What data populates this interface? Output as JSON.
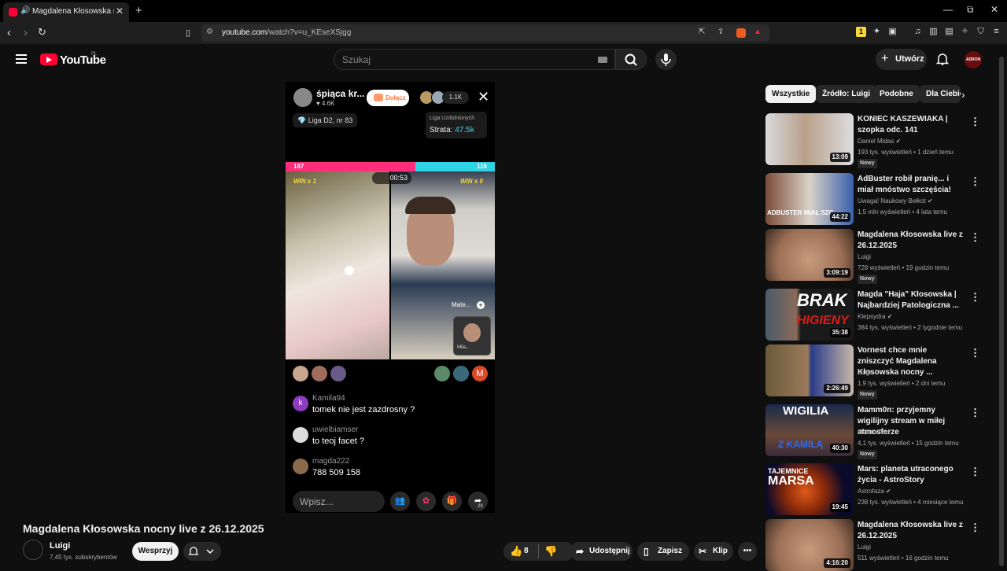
{
  "browser": {
    "tab_title": "Magdalena Kłosowska nocny",
    "tab_close": "✕",
    "new_tab": "+",
    "win_min": "—",
    "win_max": "⧉",
    "win_close": "✕",
    "url_domain": "youtube.com",
    "url_path": "/watch?v=u_KEseXSjgg"
  },
  "header": {
    "logo_text": "YouTube",
    "country": "PL",
    "search_placeholder": "Szukaj",
    "create_label": "Utwórz",
    "avatar_text": "ADRON"
  },
  "player": {
    "host_name": "śpiąca kr...",
    "host_likes": "♥ 4.6K",
    "join_label": "Dołącz",
    "viewer_count": "1.1K",
    "league": "Liga D2, nr 83",
    "strata_title": "Liga Uzdolnionych",
    "strata_label": "Strata: ",
    "strata_value": "47.5k",
    "score_left": "187",
    "score_right": "116",
    "win_left": "WIN x 1",
    "win_right": "WIN x 0",
    "timer": "00:53",
    "guest_name": "Mate...",
    "pip_name": "Mila...",
    "chat": [
      {
        "user": "Kamila94",
        "text": "tomek nie jest zazdrosny ?",
        "avatar_letter": "k"
      },
      {
        "user": "uwielbiamser",
        "text": "to teoj facet ?",
        "avatar_letter": ""
      },
      {
        "user": "magda222",
        "text": "788 509 158",
        "avatar_letter": ""
      }
    ],
    "input_placeholder": "Wpisz...",
    "share_count": "29"
  },
  "video": {
    "title": "Magdalena Kłosowska nocny live z 26.12.2025",
    "channel": "Luigi",
    "subscribers": "7,45 tys. subskrybentów",
    "support_label": "Wesprzyj",
    "like_count": "8",
    "share_label": "Udostępnij",
    "save_label": "Zapisz",
    "clip_label": "Klip"
  },
  "chips": [
    "Wszystkie",
    "Źródło: Luigi",
    "Podobne",
    "Dla Ciebie"
  ],
  "recommendations": [
    {
      "title": "KONIEC KASZEWIAKA | szopka odc. 141",
      "channel": "Daniel Midas",
      "meta": "193 tys. wyświetleń • 1 dzień temu",
      "duration": "13:09",
      "new": "Nowy",
      "verified": true
    },
    {
      "title": "AdBuster robił pranię... i miał mnóstwo szczęścia!",
      "channel": "Uwaga! Naukowy Bełkot",
      "meta": "1,5 mln wyświetleń • 4 lata temu",
      "duration": "44:22",
      "new": "",
      "verified": true
    },
    {
      "title": "Magdalena Kłosowska live z 26.12.2025",
      "channel": "Luigi",
      "meta": "728 wyświetleń • 19 godzin temu",
      "duration": "3:09:19",
      "new": "Nowy",
      "verified": false
    },
    {
      "title": "Magda \"Haja\" Kłosowska | Najbardziej Patologiczna ...",
      "channel": "Klepsydra",
      "meta": "384 tys. wyświetleń • 2 tygodnie temu",
      "duration": "35:38",
      "new": "",
      "verified": true
    },
    {
      "title": "Vornest chce mnie zniszczyć Magdalena Kłosowska nocny ...",
      "channel": "Luigi",
      "meta": "1,9 tys. wyświetleń • 2 dni temu",
      "duration": "2:26:49",
      "new": "Nowy",
      "verified": false
    },
    {
      "title": "Mamm0n: przyjemny wigilijny stream w miłej atmosferze",
      "channel": "Ostatni Raz",
      "meta": "4,1 tys. wyświetleń • 15 godzin temu",
      "duration": "40:30",
      "new": "Nowy",
      "verified": false
    },
    {
      "title": "Mars: planeta utraconego życia - AstroStory",
      "channel": "Astrofaza",
      "meta": "238 tys. wyświetleń • 4 miesiące temu",
      "duration": "19:45",
      "new": "",
      "verified": true
    },
    {
      "title": "Magdalena Kłosowska live z 26.12.2025",
      "channel": "Luigi",
      "meta": "511 wyświetleń • 16 godzin temu",
      "duration": "4:16:20",
      "new": "",
      "verified": false
    }
  ],
  "thumb_texts": {
    "t2": "ADBUSTER MIAŁ SZC",
    "t4a": "BRAK",
    "t4b": "HIGIENY",
    "t6a": "WIGILIA",
    "t6b": "Z KAMILĄ",
    "t7a": "TAJEMNICE",
    "t7b": "MARSA"
  },
  "colors": {
    "brand": "#ff0033",
    "accent_teal": "#2fd3e6",
    "accent_pink": "#ff2d7a"
  }
}
